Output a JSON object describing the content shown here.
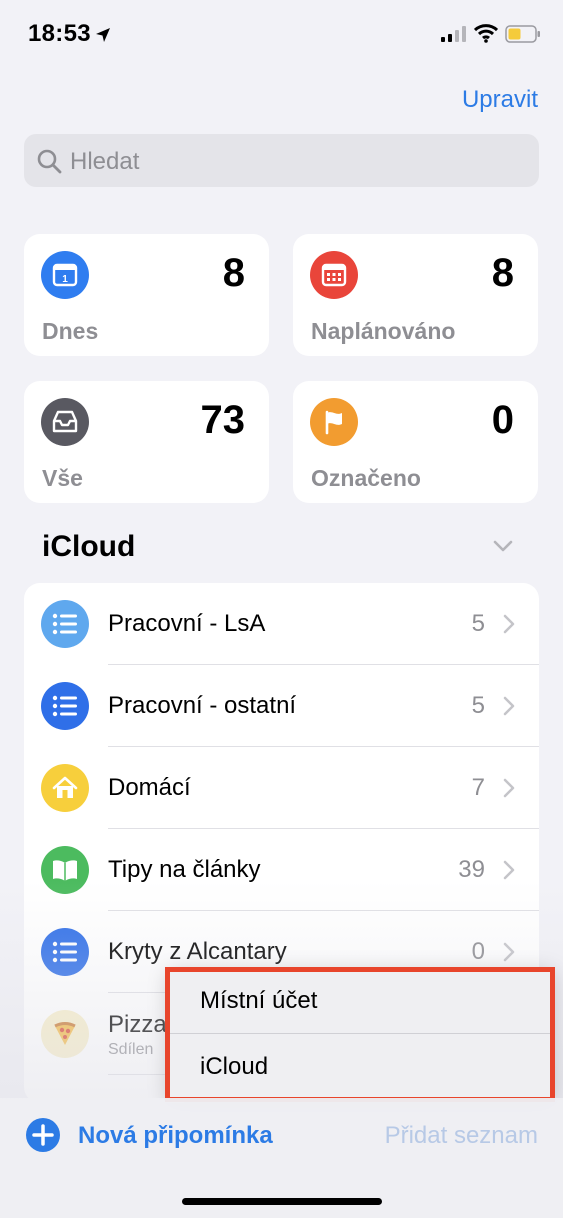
{
  "status": {
    "time": "18:53"
  },
  "header": {
    "edit_label": "Upravit"
  },
  "search": {
    "placeholder": "Hledat"
  },
  "smart_lists": [
    {
      "label": "Dnes",
      "count": "8",
      "color": "#2f7df0",
      "icon": "calendar-today-icon"
    },
    {
      "label": "Naplánováno",
      "count": "8",
      "color": "#e9453a",
      "icon": "calendar-grid-icon"
    },
    {
      "label": "Vše",
      "count": "73",
      "color": "#595961",
      "icon": "tray-icon"
    },
    {
      "label": "Označeno",
      "count": "0",
      "color": "#f29c30",
      "icon": "flag-icon"
    }
  ],
  "section": {
    "title": "iCloud"
  },
  "lists": [
    {
      "name": "Pracovní - LsA",
      "count": "5",
      "color": "#5fa8ee",
      "icon": "list-icon"
    },
    {
      "name": "Pracovní - ostatní",
      "count": "5",
      "color": "#2f6fe8",
      "icon": "list-icon"
    },
    {
      "name": "Domácí",
      "count": "7",
      "color": "#f7cf3c",
      "icon": "house-icon"
    },
    {
      "name": "Tipy na články",
      "count": "39",
      "color": "#4cbb5f",
      "icon": "book-icon"
    },
    {
      "name": "Kryty z Alcantary",
      "count": "0",
      "color": "#2f6fe8",
      "icon": "list-icon"
    },
    {
      "name": "Pizza C",
      "sub": "Sdílen",
      "color": "#f7eec9",
      "icon": "pizza-icon"
    }
  ],
  "menu": {
    "items": [
      "Místní účet",
      "iCloud"
    ]
  },
  "toolbar": {
    "new_reminder": "Nová připomínka",
    "add_list": "Přidat seznam"
  }
}
